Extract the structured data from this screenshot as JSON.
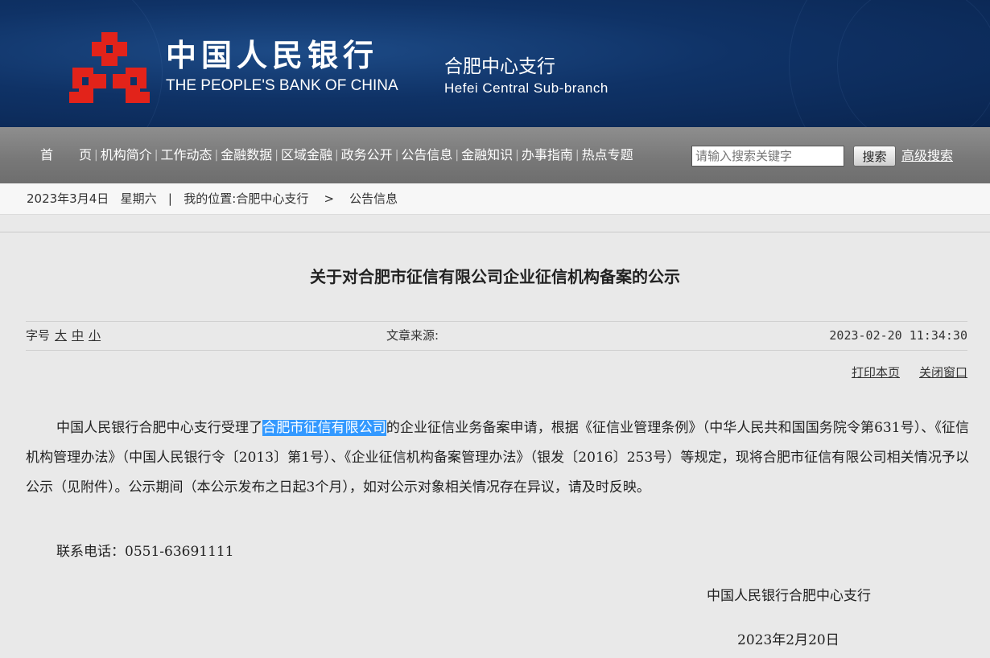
{
  "header": {
    "bank_name_cn": "中国人民银行",
    "bank_name_en": "THE PEOPLE'S BANK OF CHINA",
    "branch_cn": "合肥中心支行",
    "branch_en": "Hefei Central Sub-branch",
    "logo_color": "#e2231a",
    "bg_color": "#0f3266"
  },
  "nav": {
    "items": [
      "首　　页",
      "机构简介",
      "工作动态",
      "金融数据",
      "区域金融",
      "政务公开",
      "公告信息",
      "金融知识",
      "办事指南",
      "热点专题"
    ],
    "search_placeholder": "请输入搜索关键字",
    "search_button": "搜索",
    "advanced_search": "高级搜索"
  },
  "crumbbar": {
    "date": "2023年3月4日",
    "weekday": "星期六",
    "separator": "|",
    "location_label": "我的位置:",
    "path": [
      "合肥中心支行",
      "公告信息"
    ],
    "path_sep": ">"
  },
  "article": {
    "title": "关于对合肥市征信有限公司企业征信机构备案的公示",
    "font_size_label": "字号",
    "font_sizes": [
      "大",
      "中",
      "小"
    ],
    "source_label": "文章来源:",
    "published": "2023-02-20 11:34:30",
    "print_label": "打印本页",
    "close_label": "关闭窗口",
    "para_prefix": "中国人民银行合肥中心支行受理了",
    "para_highlight": "合肥市征信有限公司",
    "para_rest": "的企业征信业务备案申请，根据《征信业管理条例》（中华人民共和国国务院令第631号）、《征信机构管理办法》（中国人民银行令〔2013〕第1号）、《企业征信机构备案管理办法》（银发〔2016〕253号）等规定，现将合肥市征信有限公司相关情况予以公示（见附件）。公示期间（本公示发布之日起3个月），如对公示对象相关情况存在异议，请及时反映。",
    "contact": "联系电话：0551-63691111",
    "signature_org": "中国人民银行合肥中心支行",
    "signature_date": "2023年2月20日"
  }
}
